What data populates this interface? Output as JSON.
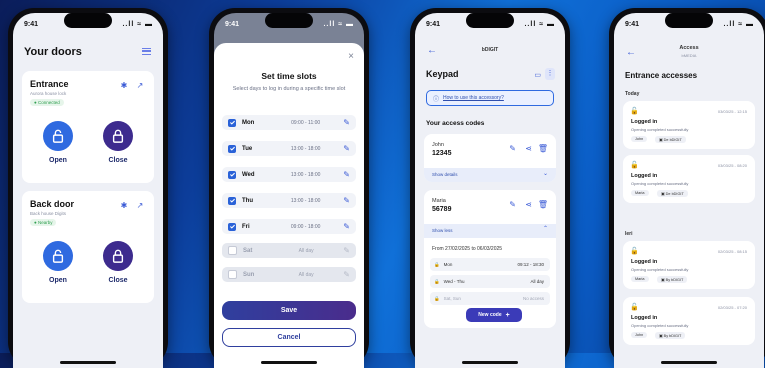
{
  "status": {
    "time": "9:41",
    "icons": "..ll ≈ ▬"
  },
  "doors": {
    "title": "Your doors",
    "entrance": {
      "name": "Entrance",
      "sub": "Aurora house lock",
      "badge": "Connected",
      "open": "Open",
      "close": "Close"
    },
    "back": {
      "name": "Back door",
      "sub": "Back house Digits",
      "badge": "Nearby",
      "open": "Open",
      "close": "Close"
    }
  },
  "slots": {
    "title": "Set time slots",
    "desc": "Select days to log in during a specific time slot",
    "days": [
      {
        "day": "Mon",
        "time": "09:00 - 11:00"
      },
      {
        "day": "Tue",
        "time": "13:00 - 18:00"
      },
      {
        "day": "Wed",
        "time": "13:00 - 18:00"
      },
      {
        "day": "Thu",
        "time": "13:00 - 18:00"
      },
      {
        "day": "Fri",
        "time": "09:00 - 18:00"
      },
      {
        "day": "Sat",
        "time": "All day"
      },
      {
        "day": "Sun",
        "time": "All day"
      }
    ],
    "save": "Save",
    "cancel": "Cancel"
  },
  "keypad": {
    "header": "bDIGIT",
    "title": "Keypad",
    "how_to": "How to use this accessory?",
    "codes_title": "Your access codes",
    "code1": {
      "name": "John",
      "code": "12345",
      "details": "Show details"
    },
    "code2": {
      "name": "Maria",
      "code": "56789",
      "less": "Show less"
    },
    "range": "From 27/02/2025 to 06/03/2025",
    "rules": [
      {
        "day": "Mon",
        "time": "09:12 - 18:30"
      },
      {
        "day": "Wed - Thu",
        "time": "All day"
      },
      {
        "day": "Sat, Sun",
        "time": "No access"
      }
    ],
    "new_code": "New code"
  },
  "access": {
    "title": "Access",
    "subtitle": "bMEDIA",
    "heading": "Entrance accesses",
    "groups": [
      "Today",
      "Ieri"
    ],
    "entries": [
      {
        "date": "03/03/25 - 12:15",
        "title": "Logged in",
        "desc": "Opening completed successfully",
        "user": "John",
        "tag": "De bDIGIT"
      },
      {
        "date": "03/03/25 - 08:20",
        "title": "Logged in",
        "desc": "Opening completed successfully",
        "user": "Maria",
        "tag": "De bDIGIT"
      },
      {
        "date": "02/03/25 - 08:15",
        "title": "Logged in",
        "desc": "Opening completed successfully",
        "user": "Maria",
        "tag": "By bDIGIT"
      },
      {
        "date": "02/03/25 - 07:20",
        "title": "Logged in",
        "desc": "Opening completed successfully",
        "user": "John",
        "tag": "By bDIGIT"
      }
    ]
  },
  "colors": {
    "navy": "#1d2a6b",
    "accent": "#2a62d8",
    "green": "#2e9e4f",
    "bg": "#eef0f6"
  }
}
